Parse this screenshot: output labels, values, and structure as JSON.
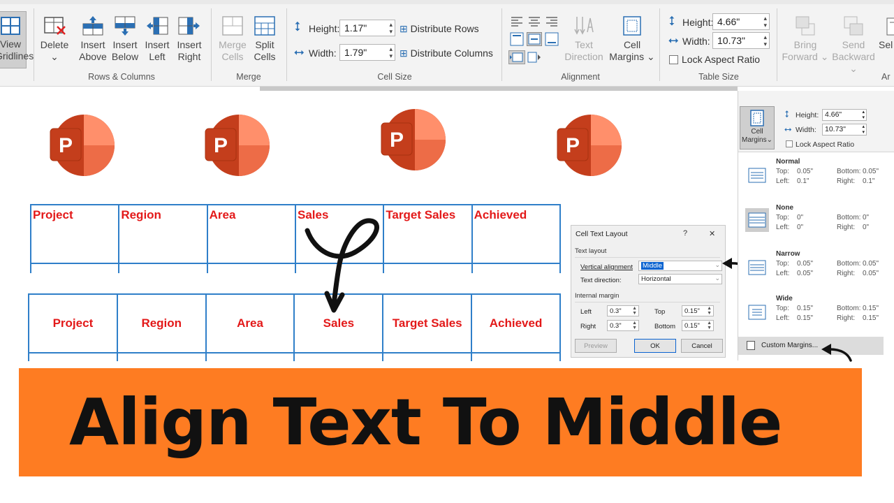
{
  "ribbon": {
    "view_gridlines": {
      "line1": "View",
      "line2": "Gridlines"
    },
    "rows_columns": {
      "delete": "Delete",
      "insert_above": {
        "line1": "Insert",
        "line2": "Above"
      },
      "insert_below": {
        "line1": "Insert",
        "line2": "Below"
      },
      "insert_left": {
        "line1": "Insert",
        "line2": "Left"
      },
      "insert_right": {
        "line1": "Insert",
        "line2": "Right"
      },
      "group_label": "Rows & Columns"
    },
    "merge": {
      "merge_cells": {
        "line1": "Merge",
        "line2": "Cells"
      },
      "split_cells": {
        "line1": "Split",
        "line2": "Cells"
      },
      "group_label": "Merge"
    },
    "cell_size": {
      "height_label": "Height:",
      "height_value": "1.17\"",
      "width_label": "Width:",
      "width_value": "1.79\"",
      "distribute_rows": "Distribute Rows",
      "distribute_columns": "Distribute Columns",
      "group_label": "Cell Size"
    },
    "alignment": {
      "text_direction": {
        "line1": "Text",
        "line2": "Direction"
      },
      "cell_margins": {
        "line1": "Cell",
        "line2": "Margins"
      },
      "group_label": "Alignment"
    },
    "table_size": {
      "height_label": "Height:",
      "height_value": "4.66\"",
      "width_label": "Width:",
      "width_value": "10.73\"",
      "lock_aspect": "Lock Aspect Ratio",
      "group_label": "Table Size"
    },
    "arrange": {
      "bring_forward": {
        "line1": "Bring",
        "line2": "Forward"
      },
      "send_backward": {
        "line1": "Send",
        "line2": "Backward"
      },
      "selection_pane": {
        "line1": "Sel",
        "line2": ""
      },
      "group_label": "Ar"
    }
  },
  "ppt_logo_letter": "P",
  "table_top": {
    "headers": [
      "Project",
      "Region",
      "Area",
      "Sales",
      "Target Sales",
      "Achieved"
    ]
  },
  "table_bottom": {
    "headers": [
      "Project",
      "Region",
      "Area",
      "Sales",
      "Target Sales",
      "Achieved"
    ]
  },
  "dialog": {
    "title": "Cell Text Layout",
    "help": "?",
    "close": "✕",
    "section_layout": "Text layout",
    "vertical_alignment_label": "Vertical alignment",
    "vertical_alignment_value": "Middle",
    "text_direction_label": "Text direction:",
    "text_direction_value": "Horizontal",
    "section_margin": "Internal margin",
    "left_label": "Left",
    "left_value": "0.3\"",
    "right_label": "Right",
    "right_value": "0.3\"",
    "top_label": "Top",
    "top_value": "0.15\"",
    "bottom_label": "Bottom",
    "bottom_value": "0.15\"",
    "preview": "Preview",
    "ok": "OK",
    "cancel": "Cancel"
  },
  "margins_panel": {
    "cell_margins": {
      "line1": "Cell",
      "line2": "Margins"
    },
    "height_label": "Height:",
    "height_value": "4.66\"",
    "width_label": "Width:",
    "width_value": "10.73\"",
    "lock_aspect": "Lock Aspect Ratio",
    "options": [
      {
        "name": "Normal",
        "top": "0.05\"",
        "bottom": "0.05\"",
        "left": "0.1\"",
        "right": "0.1\""
      },
      {
        "name": "None",
        "top": "0\"",
        "bottom": "0\"",
        "left": "0\"",
        "right": "0\""
      },
      {
        "name": "Narrow",
        "top": "0.05\"",
        "bottom": "0.05\"",
        "left": "0.05\"",
        "right": "0.05\""
      },
      {
        "name": "Wide",
        "top": "0.15\"",
        "bottom": "0.15\"",
        "left": "0.15\"",
        "right": "0.15\""
      }
    ],
    "labels": {
      "top": "Top:",
      "bottom": "Bottom:",
      "left": "Left:",
      "right": "Right:"
    },
    "custom_margins": "Custom Margins..."
  },
  "banner": {
    "text": "Align Text To Middle"
  },
  "colors": {
    "banner": "#fe7c22",
    "table_border": "#2f7fc9",
    "table_text": "#e31919",
    "ppt_dark": "#c43e1c",
    "ppt_mid": "#ed6c47",
    "ppt_light": "#ff8f6b"
  }
}
